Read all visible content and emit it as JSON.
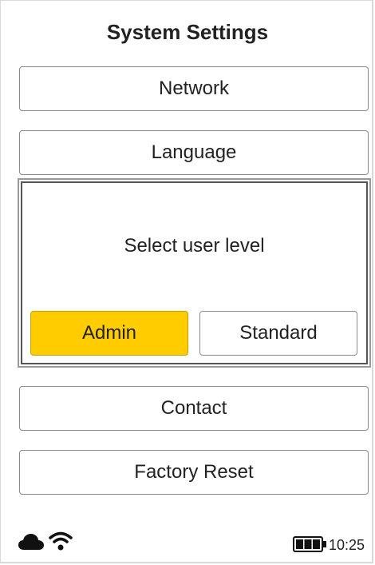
{
  "header": {
    "title": "System Settings"
  },
  "menu": {
    "items": [
      {
        "label": "Network"
      },
      {
        "label": "Language"
      },
      {
        "label": ""
      },
      {
        "label": ""
      },
      {
        "label": ""
      },
      {
        "label": "Contact"
      },
      {
        "label": "Factory Reset"
      }
    ]
  },
  "dialog": {
    "message": "Select user level",
    "options": [
      {
        "label": "Admin",
        "selected": true
      },
      {
        "label": "Standard",
        "selected": false
      }
    ]
  },
  "status_bar": {
    "icons": [
      "cloud-icon",
      "wifi-icon",
      "battery-icon"
    ],
    "battery_level": 1.0,
    "time": "10:25"
  },
  "colors": {
    "accent": "#ffcc00",
    "text": "#222222",
    "border": "#8a8a8a"
  }
}
